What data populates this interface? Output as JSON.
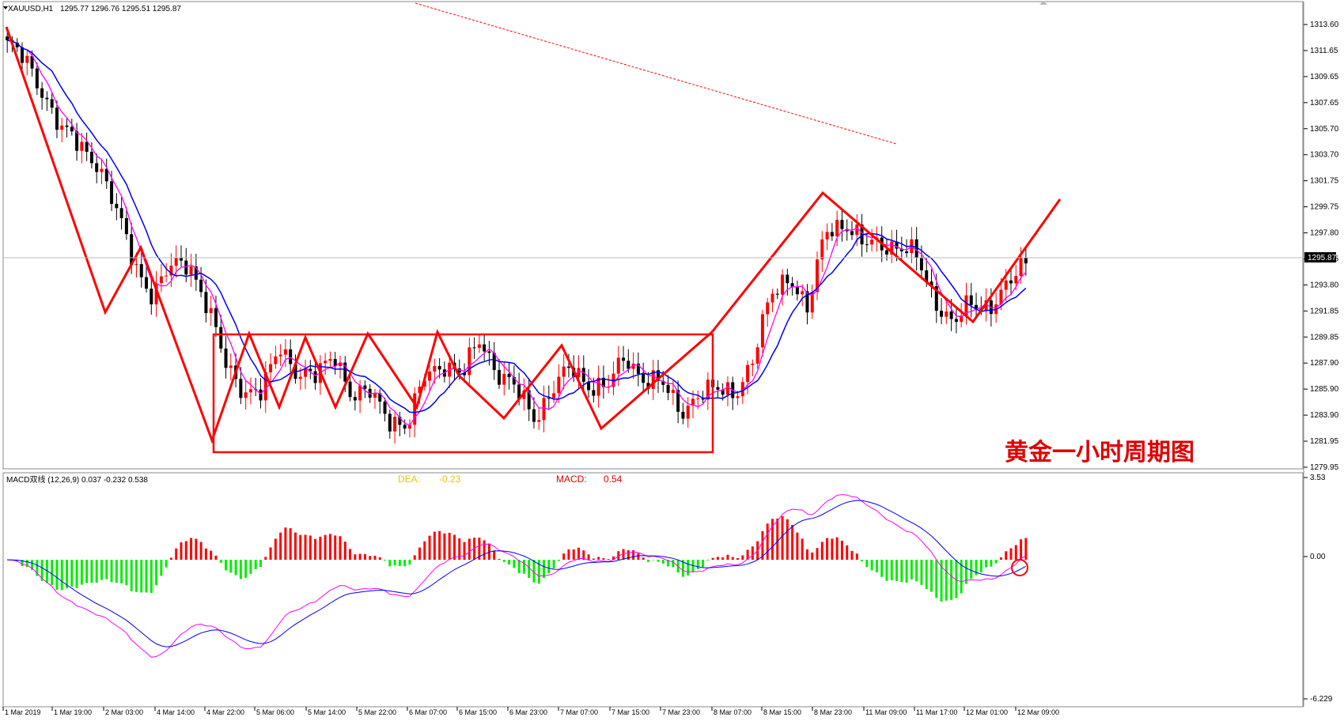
{
  "chart_data": [
    {
      "type": "candlestick",
      "symbol_header": "XAUUSD,H1",
      "ohlc_header": "1295.77 1296.76 1295.51 1295.87",
      "annotation": "黄金一小时周期图",
      "current_price_label": "1295.87",
      "ylim": [
        1279.95,
        1315.2
      ],
      "yticks": [
        "1313.60",
        "1311.65",
        "1309.65",
        "1307.65",
        "1305.70",
        "1303.70",
        "1301.75",
        "1299.75",
        "1297.80",
        "1295.85",
        "1293.80",
        "1291.85",
        "1289.85",
        "1287.90",
        "1285.90",
        "1283.90",
        "1281.95",
        "1279.95"
      ],
      "xticks": [
        "1 Mar 2019",
        "1 Mar 19:00",
        "2 Mar 03:00",
        "4 Mar 14:00",
        "4 Mar 22:00",
        "5 Mar 06:00",
        "5 Mar 14:00",
        "5 Mar 22:00",
        "6 Mar 07:00",
        "6 Mar 15:00",
        "6 Mar 23:00",
        "7 Mar 07:00",
        "7 Mar 15:00",
        "7 Mar 23:00",
        "8 Mar 07:00",
        "8 Mar 15:00",
        "8 Mar 23:00",
        "11 Mar 09:00",
        "11 Mar 17:00",
        "12 Mar 01:00",
        "12 Mar 09:00"
      ],
      "price_path_key": [
        1313.4,
        1312.0,
        1309.6,
        1306.5,
        1305.3,
        1304.0,
        1300.0,
        1296.0,
        1293.4,
        1295.6,
        1296.2,
        1292.5,
        1287.9,
        1286.0,
        1285.6,
        1289.4,
        1287.3,
        1286.8,
        1288.9,
        1285.3,
        1285.6,
        1283.8,
        1282.8,
        1287.2,
        1288.1,
        1286.9,
        1290.1,
        1287.2,
        1285.8,
        1283.8,
        1286.0,
        1287.6,
        1286.4,
        1286.1,
        1288.5,
        1286.9,
        1286.3,
        1284.2,
        1285.6,
        1285.8,
        1285.8,
        1288.2,
        1293.5,
        1295.2,
        1292.0,
        1298.8,
        1299.2,
        1297.4,
        1297.7,
        1297.2,
        1296.4,
        1293.2,
        1291.0,
        1292.8,
        1292.6,
        1294.0,
        1296.2
      ],
      "ma_fast_color": "#ff00ff",
      "ma_slow_color": "#0000ee",
      "bull_color": "#ff0000",
      "bear_color": "#000000"
    },
    {
      "type": "bar",
      "indicator_header": "MACD双线 (12,26,9) 0.037 -0.232 0.538",
      "dea_label": "DEA:",
      "dea_value": "-0.23",
      "macd_label": "MACD:",
      "macd_value": "0.54",
      "ylim": [
        -6.229,
        3.53
      ],
      "yticks": [
        "3.53",
        "0.00",
        "-6.229"
      ],
      "positive_color": "#ff0000",
      "negative_color": "#00ee00",
      "dif_color": "#ff00ff",
      "dea_color": "#0000ee"
    }
  ]
}
